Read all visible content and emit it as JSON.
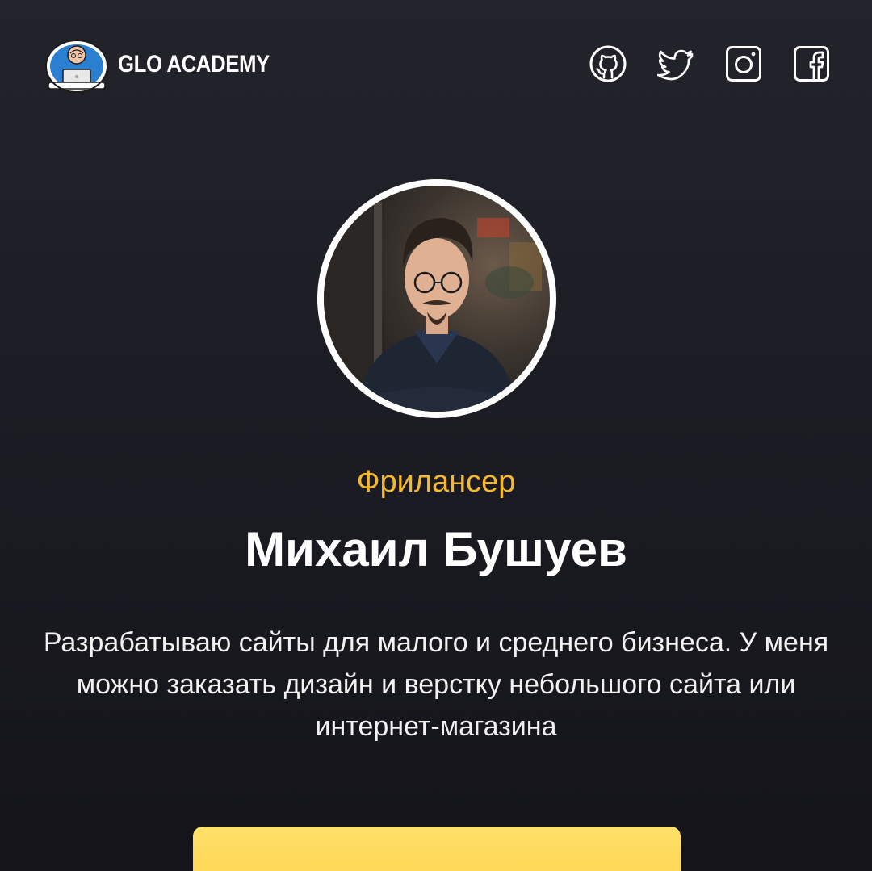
{
  "header": {
    "logo_text": "GLO ACADEMY",
    "social_links": [
      {
        "name": "github",
        "icon": "github-icon"
      },
      {
        "name": "twitter",
        "icon": "twitter-icon"
      },
      {
        "name": "instagram",
        "icon": "instagram-icon"
      },
      {
        "name": "facebook",
        "icon": "facebook-icon"
      }
    ]
  },
  "profile": {
    "role": "Фрилансер",
    "name": "Михаил Бушуев",
    "description": "Разрабатываю сайты для малого и среднего бизнеса. У меня можно заказать дизайн и верстку небольшого сайта или интернет-магазина",
    "cta_label": ""
  },
  "colors": {
    "accent": "#f5b82e",
    "cta": "#fdd24a",
    "background": "#1c1c24",
    "text": "#ffffff"
  }
}
